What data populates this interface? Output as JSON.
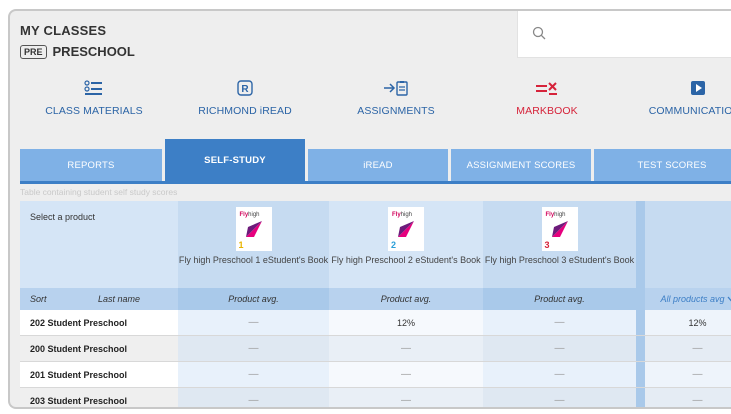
{
  "header": {
    "title": "MY CLASSES",
    "level_badge": "PRE",
    "level_name": "PRESCHOOL"
  },
  "search": {
    "placeholder": ""
  },
  "nav": [
    {
      "label": "CLASS MATERIALS",
      "icon": "list-icon",
      "active": false
    },
    {
      "label": "RICHMOND iREAD",
      "icon": "richmond-r-icon",
      "active": false
    },
    {
      "label": "ASSIGNMENTS",
      "icon": "assignment-arrow-icon",
      "active": false
    },
    {
      "label": "MARKBOOK",
      "icon": "markbook-icon",
      "active": true
    },
    {
      "label": "COMMUNICATIONS",
      "icon": "play-icon",
      "active": false
    }
  ],
  "tabs": [
    {
      "label": "REPORTS",
      "active": false
    },
    {
      "label": "SELF-STUDY",
      "active": true
    },
    {
      "label": "iREAD",
      "active": false
    },
    {
      "label": "ASSIGNMENT SCORES",
      "active": false
    },
    {
      "label": "TEST SCORES",
      "active": false
    }
  ],
  "table": {
    "caption": "Table containing student self study scores",
    "select_label": "Select a product",
    "products": [
      {
        "brand": "Fly",
        "brand_suffix": "high",
        "number": "1",
        "name": "Fly high Preschool 1 eStudent's Book",
        "number_color": "#e8b400"
      },
      {
        "brand": "Fly",
        "brand_suffix": "high",
        "number": "2",
        "name": "Fly high Preschool 2 eStudent's Book",
        "number_color": "#2a9fd8"
      },
      {
        "brand": "Fly",
        "brand_suffix": "high",
        "number": "3",
        "name": "Fly high Preschool 3 eStudent's Book",
        "number_color": "#d6233a"
      }
    ],
    "sort_label": "Sort",
    "last_name_label": "Last name",
    "product_avg_label": "Product avg.",
    "all_avg_label": "All products avg",
    "rows": [
      {
        "name": "202 Student Preschool",
        "p1": "—",
        "p2": "12%",
        "p3": "—",
        "all": "12%"
      },
      {
        "name": "200 Student Preschool",
        "p1": "—",
        "p2": "—",
        "p3": "—",
        "all": "—"
      },
      {
        "name": "201 Student Preschool",
        "p1": "—",
        "p2": "—",
        "p3": "—",
        "all": "—"
      },
      {
        "name": "203 Student Preschool",
        "p1": "—",
        "p2": "—",
        "p3": "—",
        "all": "—"
      }
    ]
  },
  "colors": {
    "accent_blue": "#3d7fc6",
    "tab_blue": "#7fb1e6",
    "active_red": "#d6233a",
    "nav_blue": "#2b64a6"
  }
}
